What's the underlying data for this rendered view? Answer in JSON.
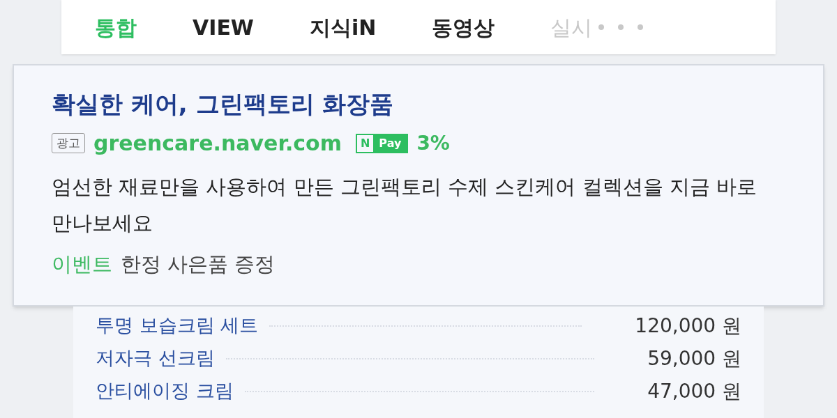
{
  "tabs": [
    {
      "label": "통합",
      "selected": true
    },
    {
      "label": "VIEW",
      "selected": false
    },
    {
      "label": "지식iN",
      "selected": false
    },
    {
      "label": "동영상",
      "selected": false
    },
    {
      "label": "실시",
      "selected": false
    }
  ],
  "ad": {
    "title": "확실한 케어, 그린팩토리 화장품",
    "badge": "광고",
    "url": "greencare.naver.com",
    "pay_mark": "N",
    "pay_label": "Pay",
    "pay_rate": "3%",
    "description": "엄선한 재료만을 사용하여 만든 그린팩토리 수제 스킨케어 컬렉션을 지금 바로 만나보세요",
    "event_label": "이벤트",
    "event_text": "한정 사은품 증정"
  },
  "products": [
    {
      "name": "투명 보습크림 세트",
      "price": "120,000 원"
    },
    {
      "name": "저자극 선크림",
      "price": "59,000 원"
    },
    {
      "name": "안티에이징 크림",
      "price": "47,000 원"
    }
  ]
}
